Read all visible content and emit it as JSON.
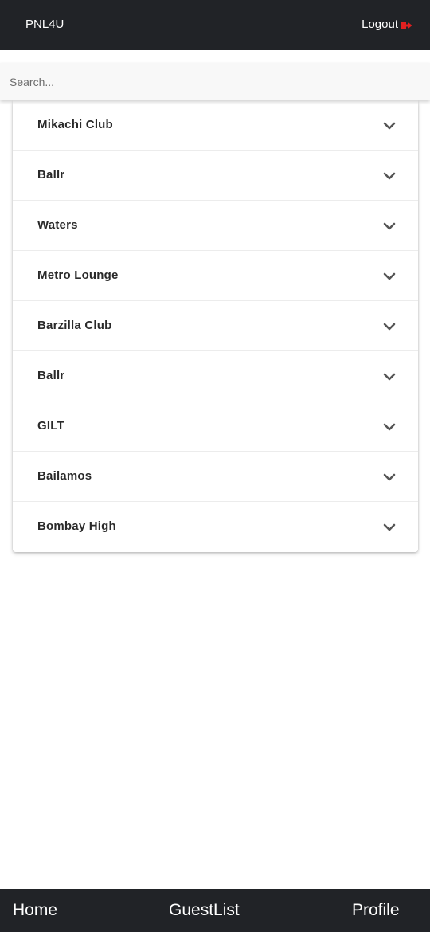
{
  "header": {
    "brand": "PNL4U",
    "logout_label": "Logout",
    "logout_icon": "sign-out-icon",
    "logout_icon_color": "#e02020",
    "background": "#212327"
  },
  "search": {
    "placeholder": "Search...",
    "value": ""
  },
  "clubs": [
    {
      "name": "Mikachi Club"
    },
    {
      "name": "Ballr"
    },
    {
      "name": "Waters"
    },
    {
      "name": "Metro Lounge"
    },
    {
      "name": "Barzilla Club"
    },
    {
      "name": "Ballr"
    },
    {
      "name": "GILT"
    },
    {
      "name": "Bailamos"
    },
    {
      "name": "Bombay High"
    }
  ],
  "bottom_nav": {
    "home": "Home",
    "guestlist": "GuestList",
    "profile": "Profile"
  }
}
